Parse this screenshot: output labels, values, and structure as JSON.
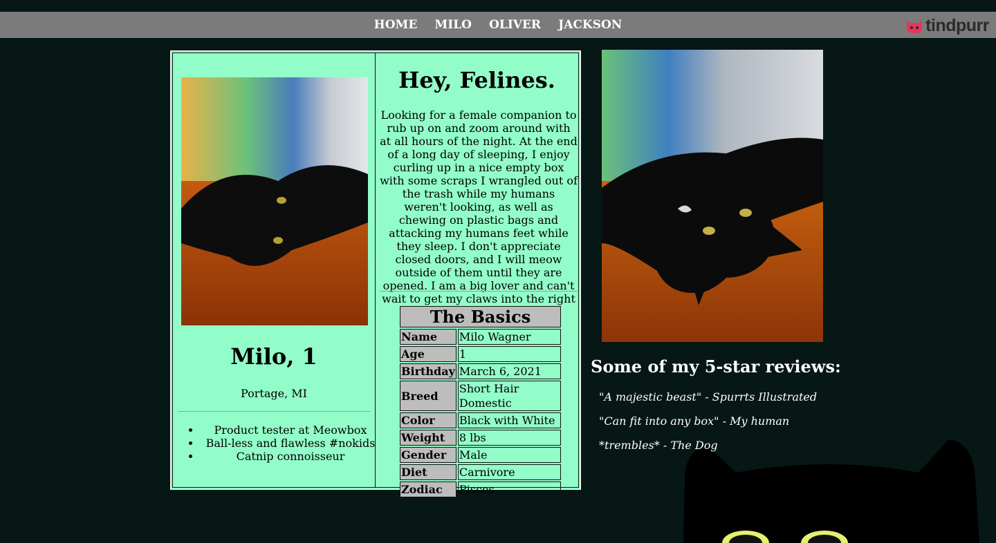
{
  "nav": {
    "links": [
      "HOME",
      "MILO",
      "OLIVER",
      "JACKSON"
    ],
    "brand": "tindpurr",
    "brand_icon": "cat-face-icon"
  },
  "profile": {
    "name_age": "Milo, 1",
    "location": "Portage, MI",
    "facts": [
      "Product tester at Meowbox",
      "Ball-less and flawless #nokids",
      "Catnip connoisseur"
    ],
    "headline": "Hey, Felines.",
    "bio": "Looking for a female companion to rub up on and zoom around with at all hours of the night. At the end of a long day of sleeping, I enjoy curling up in a nice empty box with some scraps I wrangled out of the trash while my humans weren't looking, as well as chewing on plastic bags and attacking my humans feet while they sleep. I don't appreciate closed doors, and I will meow outside of them until they are opened. I am a big lover and can't wait to get my claws into the right feline. Let's play!"
  },
  "basics": {
    "title": "The Basics",
    "rows": [
      {
        "label": "Name",
        "value": "Milo Wagner"
      },
      {
        "label": "Age",
        "value": "1"
      },
      {
        "label": "Birthday",
        "value": "March 6, 2021"
      },
      {
        "label": "Breed",
        "value": "Short Hair Domestic"
      },
      {
        "label": "Color",
        "value": "Black with White"
      },
      {
        "label": "Weight",
        "value": "8 lbs"
      },
      {
        "label": "Gender",
        "value": "Male"
      },
      {
        "label": "Diet",
        "value": "Carnivore"
      },
      {
        "label": "Zodiac",
        "value": "Pisces"
      }
    ]
  },
  "reviews": {
    "title": "Some of my 5-star reviews:",
    "items": [
      "\"A majestic beast\" - Spurrts Illustrated",
      "\"Can fit into any box\" - My human",
      "*trembles* - The Dog"
    ]
  },
  "colors": {
    "page_bg": "#061716",
    "nav_bg": "#7b7b7b",
    "card_bg": "#93fdc9",
    "table_label_bg": "#bdbdbd",
    "brand_accent": "#e8335c"
  }
}
